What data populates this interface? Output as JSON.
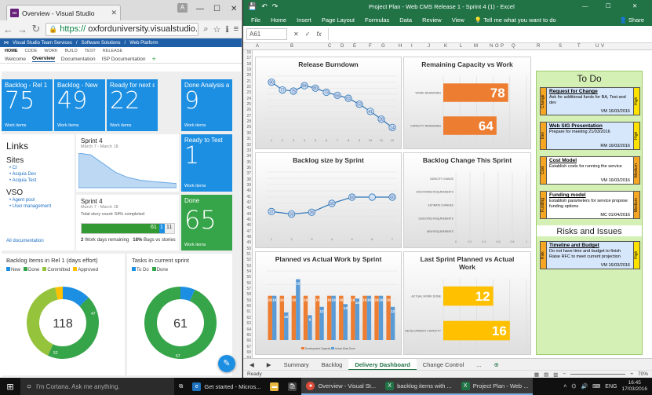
{
  "browser": {
    "tab_title": "Overview - Visual Studio",
    "user_initial": "A",
    "url_https": "https://",
    "url_rest": "oxforduniversity.visualstudio.com/Def",
    "vsts_brand": "Visual Studio Team Services",
    "vsts_breadcrumb_1": "Software Solutions",
    "vsts_breadcrumb_2": "Web Platform",
    "nav": [
      "HOME",
      "CODE",
      "WORK",
      "BUILD",
      "TEST",
      "RELEASE"
    ],
    "subnav": [
      "Welcome",
      "Overview",
      "Documentation",
      "ISP Documentation"
    ],
    "tiles": {
      "backlog_rel1": {
        "title": "Backlog - Rel 1",
        "value": "75",
        "foot": "Work items"
      },
      "backlog_new": {
        "title": "Backlog - New",
        "value": "49",
        "foot": "Work items"
      },
      "ready_next": {
        "title": "Ready for next sp...",
        "value": "22",
        "foot": "Work items"
      },
      "done_analysis": {
        "title": "Done Analysis an...",
        "value": "9",
        "foot": "Work items"
      },
      "ready_test": {
        "title": "Ready to Test",
        "value": "1",
        "foot": "Work items"
      },
      "done": {
        "title": "Done",
        "value": "65",
        "foot": "Work items"
      }
    },
    "links": {
      "heading": "Links",
      "sites_heading": "Sites",
      "sites": [
        "CI",
        "Acquia Dev",
        "Acquia Test"
      ],
      "vso_heading": "VSO",
      "vso": [
        "Agent pool",
        "User management"
      ],
      "all_docs": "All documentation"
    },
    "sprint_burndown": {
      "title": "Sprint 4",
      "dates": "March 7 - March 18"
    },
    "sprint_progress": {
      "title": "Sprint 4",
      "dates": "March 7 - March 18",
      "story_count": "Total story count: 64% completed",
      "done_label": "61",
      "prog_label": "1",
      "rem_label": "11",
      "done_fraction": 0.84,
      "prog_fraction": 0.06,
      "days_remaining": "2",
      "days_label": "Work days remaining",
      "bugs_pct": "18%",
      "bugs_label": "Bugs vs stories"
    },
    "backlog_pie": {
      "title": "Backlog Items in Rel 1 (days effort)",
      "legend": [
        "New",
        "Done",
        "Committed",
        "Approved"
      ],
      "total": "118",
      "label_done": "52",
      "label_committed": "47"
    },
    "sprint_pie": {
      "title": "Tasks in current sprint",
      "legend": [
        "To Do",
        "Done"
      ],
      "total": "61",
      "label_done": "57"
    },
    "fab_icon": "pencil-icon"
  },
  "excel": {
    "title": "Project Plan - Web CMS Release 1 - Sprint 4 (1) - Excel",
    "ribbon": [
      "File",
      "Home",
      "Insert",
      "Page Layout",
      "Formulas",
      "Data",
      "Review",
      "View",
      "Tell me what you want to do"
    ],
    "share": "Share",
    "name_box": "A61",
    "col_headers": [
      "A",
      "B",
      "C",
      "D",
      "E",
      "F",
      "G",
      "H",
      "I",
      "J",
      "K",
      "L",
      "M",
      "N",
      "O",
      "P",
      "Q",
      "R",
      "S",
      "T",
      "U",
      "V"
    ],
    "first_row": 16,
    "sheet_tabs": [
      "Summary",
      "Backlog",
      "Delivery Dashboard",
      "Change Control",
      "..."
    ],
    "active_tab": "Delivery Dashboard",
    "status": "Ready",
    "zoom": "70%",
    "todo": {
      "heading": "To Do",
      "risks_heading": "Risks and Issues",
      "cards": [
        {
          "tag": "Change",
          "title": "Request for Change",
          "body": "Ask for additional funds for BA, Test and dev",
          "sig": "VM  16/03/2016",
          "priority": "High"
        },
        {
          "tag": "Dev",
          "title": "Web SIG Presentation",
          "body": "Prepare for meeting 21/03/2016",
          "sig": "RM  16/03/2016",
          "priority": "High"
        },
        {
          "tag": "Cost",
          "title": "Cost Model",
          "body": "Establish costs for running the service",
          "sig": "VM  16/03/2016",
          "priority": "Medium"
        },
        {
          "tag": "Funding",
          "title": "Funding model",
          "body": "Establish parameters for service propose funding options",
          "sig": "MC  01/04/2016",
          "priority": "Medium"
        }
      ],
      "risk": {
        "tag": "Risk",
        "title": "Timeline and Budget",
        "body": "Do not have time and budget to finish Raise RFC to meet current projection",
        "sig": "VM  16/03/2016",
        "priority": "High"
      }
    }
  },
  "taskbar": {
    "cortana": "I'm Cortana. Ask me anything.",
    "items": [
      "Get started - Micros...",
      "Overview - Visual St...",
      "backlog items with ...",
      "Project Plan - Web ..."
    ],
    "lang": "ENG",
    "time": "16:45",
    "date": "17/03/2016"
  },
  "chart_data": [
    {
      "type": "line",
      "title": "Release Burndown",
      "x": [
        1,
        2,
        3,
        4,
        5,
        6,
        7,
        8,
        9,
        10,
        11,
        12
      ],
      "values": [
        90,
        77,
        75,
        84,
        80,
        73,
        68,
        63,
        53,
        41,
        28,
        14
      ],
      "ylim": [
        0,
        100
      ],
      "colors": {
        "line": "#2e75b6",
        "label": "#4a6fa5"
      }
    },
    {
      "type": "bar",
      "title": "Remaining Capacity vs Work",
      "categories": [
        "WORK REMAINING",
        "CAPACITY REMAINING"
      ],
      "values": [
        78,
        64
      ],
      "xlim": [
        0,
        100
      ],
      "colors": {
        "bar": "#ed7d31"
      }
    },
    {
      "type": "line",
      "title": "Backlog size by Sprint",
      "x": [
        1,
        2,
        3,
        4,
        5,
        6,
        7
      ],
      "values": [
        37,
        33,
        36,
        50,
        60,
        60,
        60
      ],
      "point_labels": [
        "37",
        "33",
        "36",
        "50",
        "60",
        "",
        "60"
      ],
      "ylim": [
        0,
        100
      ],
      "colors": {
        "line": "#2e75b6"
      }
    },
    {
      "type": "bar",
      "title": "Backlog Change This Sprint",
      "categories": [
        "CAPACITY CHANGE",
        "DISCOVERED REQUIREMENTS",
        "ESTIMATE CHANGES",
        "DESCOPED REQUIREMENTS",
        "NEW REQUIREMENTS"
      ],
      "values": [
        0,
        0,
        0,
        0,
        0
      ],
      "ticks": [
        "0",
        "0.2",
        "0.4",
        "0.6",
        "0.8",
        "1"
      ]
    },
    {
      "type": "bar",
      "title": "Planned vs Actual Work by Sprint",
      "categories": [
        "1",
        "2",
        "3",
        "4",
        "5",
        "6",
        "7",
        "8",
        "9",
        "10",
        "11"
      ],
      "series": [
        {
          "name": "Development Capacity",
          "values": [
            16,
            16,
            16,
            16,
            16,
            16,
            16,
            16,
            16,
            16,
            16
          ]
        },
        {
          "name": "Actual Work Done",
          "values": [
            16,
            10,
            22,
            9,
            12,
            16,
            13,
            15,
            16,
            16,
            12
          ]
        }
      ],
      "ylim": [
        0,
        25
      ],
      "colors": {
        "capacity": "#ed7d31",
        "actual": "#5b9bd5"
      }
    },
    {
      "type": "bar",
      "title": "Last Sprint Planned vs Actual Work",
      "categories": [
        "ACTUAL WORK DONE",
        "DEVELOPMENT CAPACITY"
      ],
      "values": [
        12,
        16
      ],
      "xlim": [
        0,
        20
      ],
      "colors": {
        "bar": "#ffc000"
      }
    },
    {
      "type": "line",
      "title": "Sprint 4",
      "values": [
        100,
        95,
        70,
        45,
        30,
        22,
        18,
        15,
        12
      ],
      "ylim": [
        0,
        100
      ],
      "colors": {
        "fill": "#bcd8f3",
        "line": "#6aa9e6"
      }
    },
    {
      "type": "pie",
      "title": "Backlog Items in Rel 1 (days effort)",
      "categories": [
        "New",
        "Done",
        "Committed",
        "Approved"
      ],
      "values": [
        15,
        52,
        47,
        4
      ],
      "colors": [
        "#1d8fe2",
        "#36a449",
        "#95c33c",
        "#ffc000"
      ]
    },
    {
      "type": "pie",
      "title": "Tasks in current sprint",
      "categories": [
        "To Do",
        "Done"
      ],
      "values": [
        4,
        57
      ],
      "colors": [
        "#1d8fe2",
        "#36a449"
      ]
    }
  ]
}
